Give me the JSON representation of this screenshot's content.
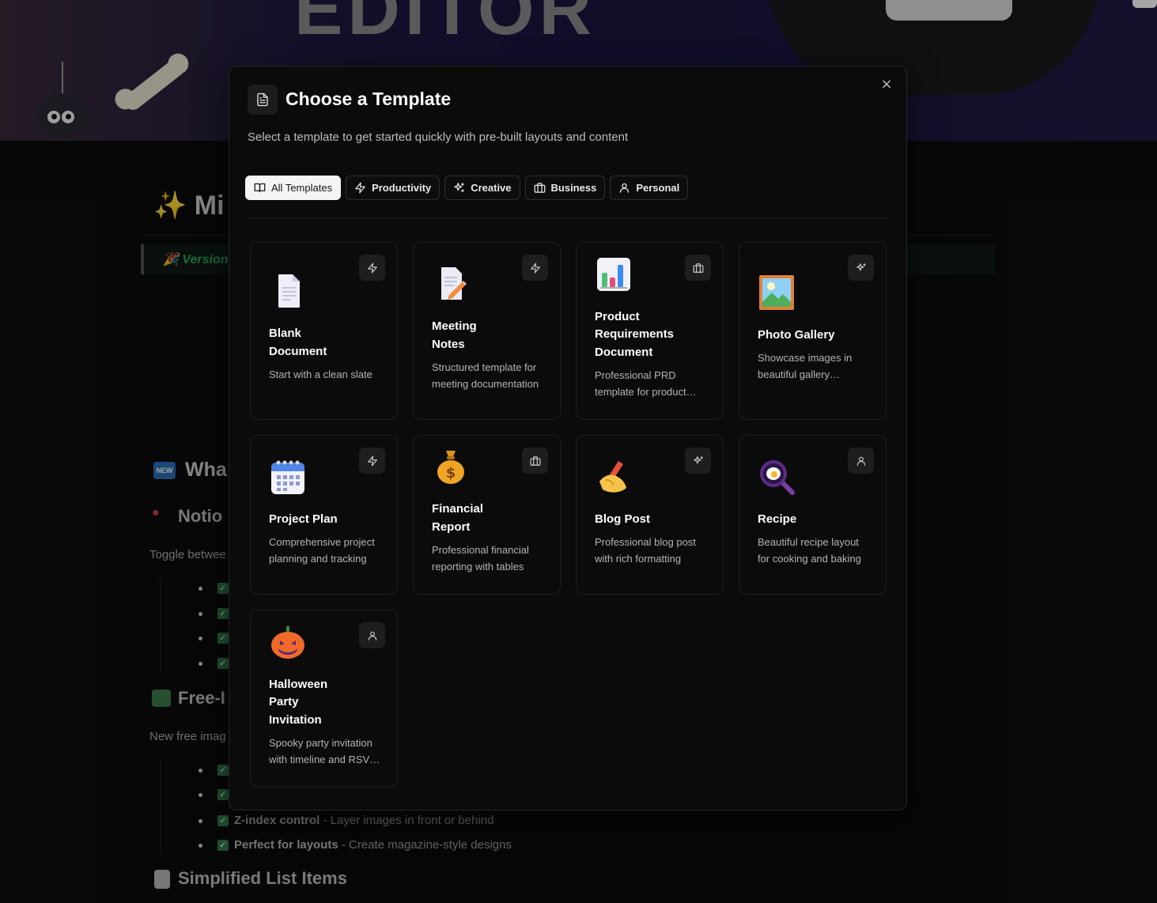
{
  "background": {
    "hero_title": "EDITOR",
    "page_title": "✨ Mi",
    "version_label": "🎉 Version",
    "whats_new_heading": "Wha",
    "notion_heading": "Notio",
    "notion_text": "Toggle betwee",
    "free_heading": "Free-I",
    "free_text": "New free imag",
    "list_items": [
      {
        "bold": "Z-index control",
        "rest": " - Layer images in front or behind"
      },
      {
        "bold": "Perfect for layouts",
        "rest": " - Create magazine-style designs"
      }
    ],
    "simplified_heading": "Simplified List Items",
    "new_badge": "NEW"
  },
  "modal": {
    "title": "Choose a Template",
    "subtitle": "Select a template to get started quickly with pre-built layouts and content",
    "close_glyph": "×",
    "tabs": [
      {
        "label": "All Templates",
        "icon": "book-icon",
        "active": true
      },
      {
        "label": "Productivity",
        "icon": "zap-icon",
        "active": false
      },
      {
        "label": "Creative",
        "icon": "sparkles-icon",
        "active": false
      },
      {
        "label": "Business",
        "icon": "briefcase-icon",
        "active": false
      },
      {
        "label": "Personal",
        "icon": "user-icon",
        "active": false
      }
    ],
    "templates": [
      {
        "title": "Blank Document",
        "desc": "Start with a clean slate",
        "emoji": "blank-page",
        "category": "zap-icon"
      },
      {
        "title": "Meeting Notes",
        "desc": "Structured template for meeting documentation",
        "emoji": "memo",
        "category": "zap-icon"
      },
      {
        "title": "Product Requirements Document",
        "desc": "Professional PRD template for product…",
        "emoji": "bar-chart",
        "category": "briefcase-icon"
      },
      {
        "title": "Photo Gallery",
        "desc": "Showcase images in beautiful gallery…",
        "emoji": "framed-picture",
        "category": "sparkles-icon"
      },
      {
        "title": "Project Plan",
        "desc": "Comprehensive project planning and tracking",
        "emoji": "calendar",
        "category": "zap-icon"
      },
      {
        "title": "Financial Report",
        "desc": "Professional financial reporting with tables",
        "emoji": "money-bag",
        "category": "briefcase-icon"
      },
      {
        "title": "Blog Post",
        "desc": "Professional blog post with rich formatting",
        "emoji": "writing-hand",
        "category": "sparkles-icon"
      },
      {
        "title": "Recipe",
        "desc": "Beautiful recipe layout for cooking and baking",
        "emoji": "frying-pan",
        "category": "user-icon"
      },
      {
        "title": "Halloween Party Invitation",
        "desc": "Spooky party invitation with timeline and RSV…",
        "emoji": "jack-o-lantern",
        "category": "user-icon"
      }
    ]
  }
}
